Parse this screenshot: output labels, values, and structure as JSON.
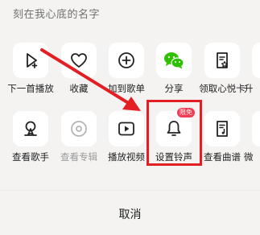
{
  "sheet": {
    "title": "刻在我心底的名字",
    "row1": [
      {
        "label": "下一首播放",
        "icon": "play-next-icon"
      },
      {
        "label": "收藏",
        "icon": "heart-icon"
      },
      {
        "label": "加到歌单",
        "icon": "add-playlist-icon"
      },
      {
        "label": "分享",
        "icon": "wechat-icon"
      },
      {
        "label": "领取心悦卡",
        "icon": "card-star-icon"
      },
      {
        "label": "升",
        "icon": "partial-icon"
      }
    ],
    "row2": [
      {
        "label": "查看歌手",
        "icon": "singer-icon"
      },
      {
        "label": "查看专辑",
        "icon": "album-icon"
      },
      {
        "label": "播放视频",
        "icon": "video-icon"
      },
      {
        "label": "设置铃声",
        "icon": "bell-icon",
        "badge": "限免"
      },
      {
        "label": "查看曲谱",
        "icon": "sheet-music-icon"
      },
      {
        "label": "微",
        "icon": "partial-icon"
      }
    ],
    "cancel_label": "取消"
  },
  "colors": {
    "highlight": "#e31e24",
    "wechat": "#2dc100",
    "badge": "#f23b54"
  }
}
